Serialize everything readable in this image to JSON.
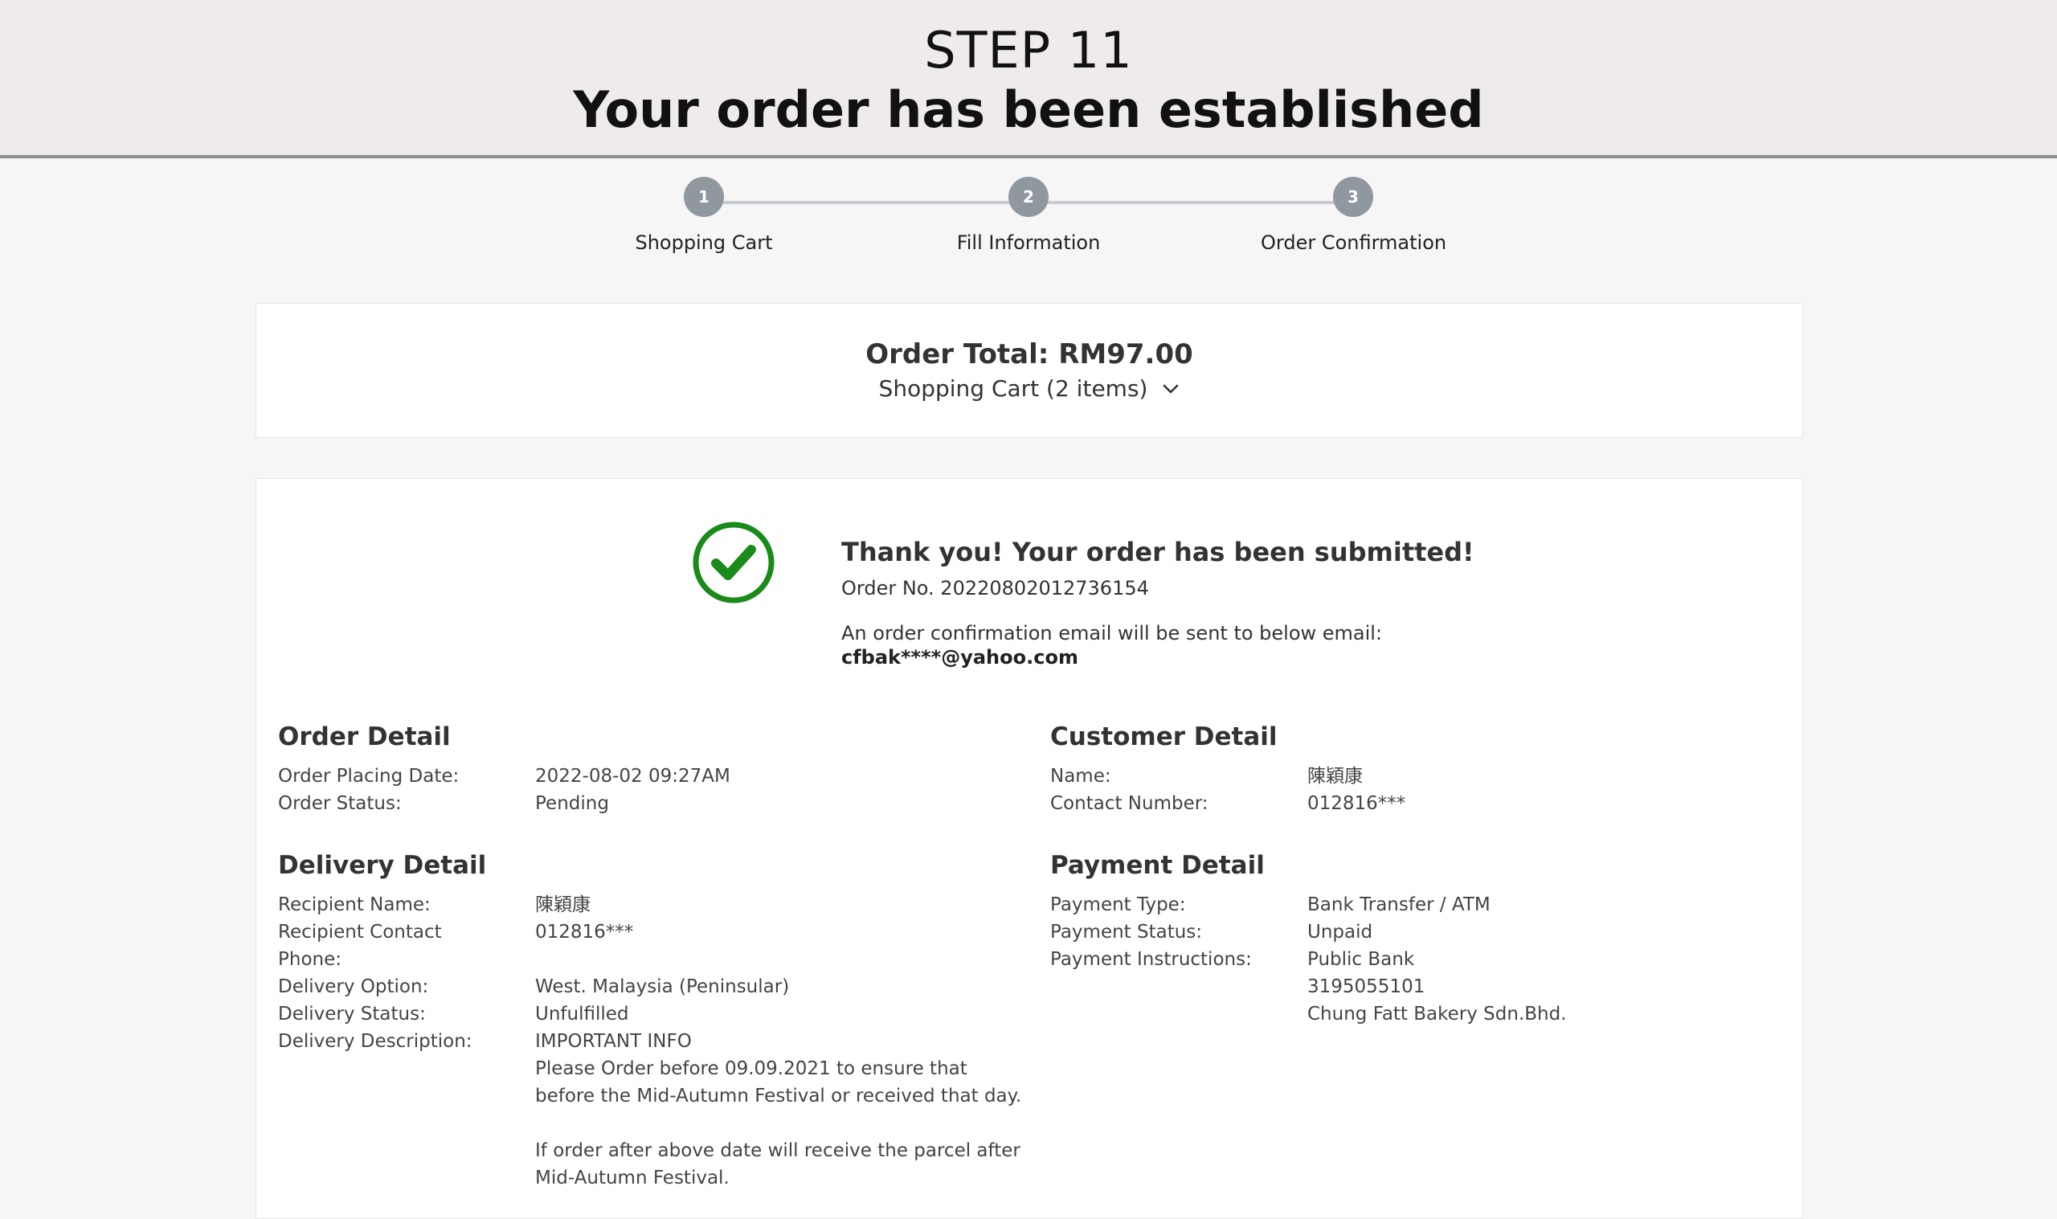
{
  "banner": {
    "step": "STEP 11",
    "headline": "Your order has been established"
  },
  "stepper": {
    "steps": [
      {
        "number": "1",
        "label": "Shopping Cart"
      },
      {
        "number": "2",
        "label": "Fill Information"
      },
      {
        "number": "3",
        "label": "Order Confirmation"
      }
    ]
  },
  "summary": {
    "order_total": "Order Total: RM97.00",
    "cart_toggle": "Shopping Cart (2 items)"
  },
  "confirmation": {
    "thanks": "Thank you! Your order has been submitted!",
    "order_no": "Order No. 20220802012736154",
    "email_note": "An order confirmation email will be sent to below email:",
    "email": "cfbak****@yahoo.com",
    "check_color": "#1a8a1a"
  },
  "order_detail": {
    "title": "Order Detail",
    "rows": [
      {
        "key": "Order Placing Date:",
        "value": "2022-08-02 09:27AM"
      },
      {
        "key": "Order Status:",
        "value": "Pending"
      }
    ]
  },
  "delivery_detail": {
    "title": "Delivery Detail",
    "rows": [
      {
        "key": "Recipient Name:",
        "value": "陳穎康"
      },
      {
        "key": "Recipient Contact Phone:",
        "value": "012816***"
      },
      {
        "key": "Delivery Option:",
        "value": "West. Malaysia (Peninsular)"
      },
      {
        "key": "Delivery Status:",
        "value": "Unfulfilled"
      },
      {
        "key": "Delivery Description:",
        "value": "IMPORTANT INFO"
      }
    ],
    "description_lines": [
      "Please Order before 09.09.2021 to ensure that",
      "before the Mid-Autumn Festival or received that day.",
      "",
      "If order after above date will receive the parcel after",
      "Mid-Autumn Festival."
    ]
  },
  "customer_detail": {
    "title": "Customer Detail",
    "rows": [
      {
        "key": "Name:",
        "value": "陳穎康"
      },
      {
        "key": "Contact Number:",
        "value": "012816***"
      }
    ]
  },
  "payment_detail": {
    "title": "Payment Detail",
    "rows": [
      {
        "key": "Payment Type:",
        "value": "Bank Transfer / ATM"
      },
      {
        "key": "Payment Status:",
        "value": "Unpaid"
      },
      {
        "key": "Payment Instructions:",
        "value": "Public Bank"
      }
    ],
    "instruction_lines": [
      "3195055101",
      "Chung Fatt Bakery Sdn.Bhd."
    ]
  }
}
